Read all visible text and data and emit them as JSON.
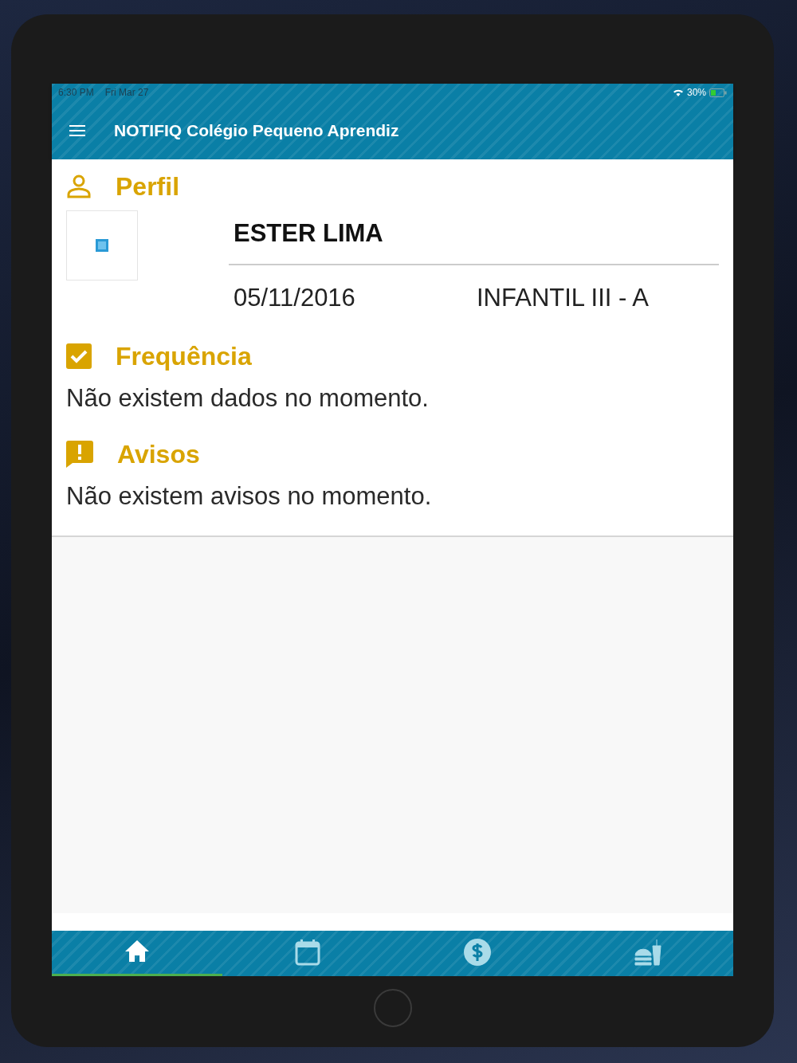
{
  "status_bar": {
    "time": "6:30 PM",
    "date": "Fri Mar 27",
    "battery": "30%"
  },
  "app_bar": {
    "title": "NOTIFIQ Colégio Pequeno Aprendiz"
  },
  "sections": [
    {
      "kind": "profile",
      "title": "Perfil",
      "name": "ESTER LIMA",
      "birth_date": "05/11/2016",
      "class": "INFANTIL III - A"
    },
    {
      "kind": "attendance",
      "title": "Frequência",
      "message": "Não existem dados no momento."
    },
    {
      "kind": "notices",
      "title": "Avisos",
      "message": "Não existem avisos no momento."
    }
  ],
  "bottom_nav": [
    {
      "kind": "home",
      "selected": true
    },
    {
      "kind": "calendar",
      "selected": false
    },
    {
      "kind": "payments",
      "selected": false
    },
    {
      "kind": "meals",
      "selected": false
    }
  ]
}
